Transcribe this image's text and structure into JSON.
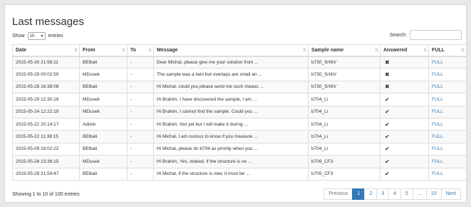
{
  "page": {
    "title": "Last messages"
  },
  "length": {
    "show_label": "Show",
    "value": "10",
    "entries_label": "entries"
  },
  "search": {
    "label": "Search:",
    "value": ""
  },
  "table": {
    "columns": [
      "Date",
      "From",
      "To",
      "Message",
      "Sample name",
      "Answered",
      "FULL"
    ],
    "rows": [
      {
        "date": "2015-05-30 21:58:11",
        "from": "BElbali",
        "to": "-",
        "message": "Dear Michal, please give me your solution from ...",
        "sample": "b730_SrNiV",
        "answered": "✖",
        "full": "FULL"
      },
      {
        "date": "2015-05-29 00:02:50",
        "from": "MDusek",
        "to": "-",
        "message": "The sample was a twin but overlaps are small an ...",
        "sample": "b730_SrNiV",
        "answered": "✖",
        "full": "FULL"
      },
      {
        "date": "2015-05-28 16:38:08",
        "from": "BElbali",
        "to": "-",
        "message": "Hi Michal, could you please send me such measu ...",
        "sample": "b730_SrNiV",
        "answered": "✖",
        "full": "FULL"
      },
      {
        "date": "2015-05-29 12:30:19",
        "from": "MDusek",
        "to": "-",
        "message": "Hi Brahim, I have discovered the sample, I am ...",
        "sample": "b704_Li",
        "answered": "✔",
        "full": "FULL"
      },
      {
        "date": "2015-05-24 12:22:19",
        "from": "MDusek",
        "to": "-",
        "message": "Hi Brahim, I cannot find the sample. Could you ...",
        "sample": "b704_Li",
        "answered": "✔",
        "full": "FULL"
      },
      {
        "date": "2015-05-22 20:14:17",
        "from": "Admin",
        "to": "-",
        "message": "Hi Brahim, Not yet but I will make it during ...",
        "sample": "b704_Li",
        "answered": "✔",
        "full": "FULL"
      },
      {
        "date": "2015-05-22 11:38:15",
        "from": "BElbali",
        "to": "-",
        "message": "Hi Michal, I am curious to know if you measure ...",
        "sample": "b704_Li",
        "answered": "✔",
        "full": "FULL"
      },
      {
        "date": "2015-05-09 18:02:22",
        "from": "BElbali",
        "to": "-",
        "message": "Hi Michal, please do b704 as priority when you ...",
        "sample": "b704_Li",
        "answered": "✔",
        "full": "FULL"
      },
      {
        "date": "2015-05-28 23:36:15",
        "from": "MDusek",
        "to": "-",
        "message": "Hi Brahim, Yes, indeed, if the structure is ne ...",
        "sample": "b709_CF3",
        "answered": "✔",
        "full": "FULL"
      },
      {
        "date": "2015-05-28 21:54:47",
        "from": "BElbali",
        "to": "-",
        "message": "Hi Michal, if the structure is new, it must be ...",
        "sample": "b709_CF3",
        "answered": "✔",
        "full": "FULL"
      }
    ]
  },
  "info": "Showing 1 to 10 of 100 entries",
  "pagination": {
    "prev": "Previous",
    "pages": [
      "1",
      "2",
      "3",
      "4",
      "5",
      "...",
      "10"
    ],
    "next": "Next",
    "active": "1"
  },
  "colors": {
    "accent": "#337ab7",
    "stripe": "#f9f9f9",
    "border": "#dddddd"
  },
  "icons": {
    "sort": "sort-both-icon",
    "no": "cross-icon",
    "yes": "check-icon",
    "select": "chevron-down-icon"
  }
}
